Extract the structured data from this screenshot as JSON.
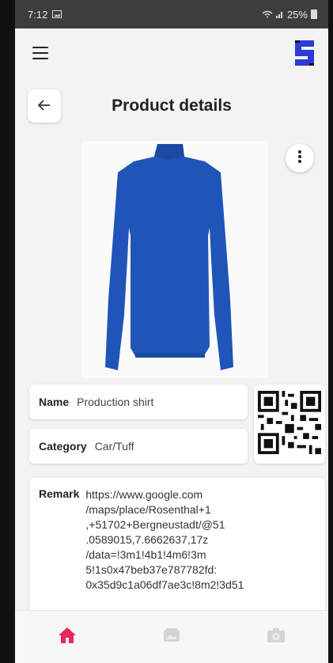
{
  "status": {
    "time": "7:12",
    "battery": "25%"
  },
  "header": {
    "logo_text": "S"
  },
  "page": {
    "title": "Product details",
    "back_icon": "arrow-left-icon"
  },
  "product": {
    "image_color": "#1f55b8",
    "name_label": "Name",
    "name_value": "Production shirt",
    "category_label": "Category",
    "category_value": "Car/Tuff",
    "remark_label": "Remark",
    "remark_lines": [
      "https://www.google.com",
      "/maps/place/Rosenthal+1",
      ",+51702+Bergneustadt/@51",
      ".0589015,7.6662637,17z",
      "/data=!3m1!4b1!4m6!3m",
      "5!1s0x47beb37e787782fd:",
      "0x35d9c1a06df7ae3c!8m2!3d51"
    ]
  },
  "nav": {
    "items": [
      "home-icon",
      "gallery-icon",
      "camera-icon"
    ],
    "active_color": "#e8265a",
    "inactive_color": "#cfcfcf"
  }
}
